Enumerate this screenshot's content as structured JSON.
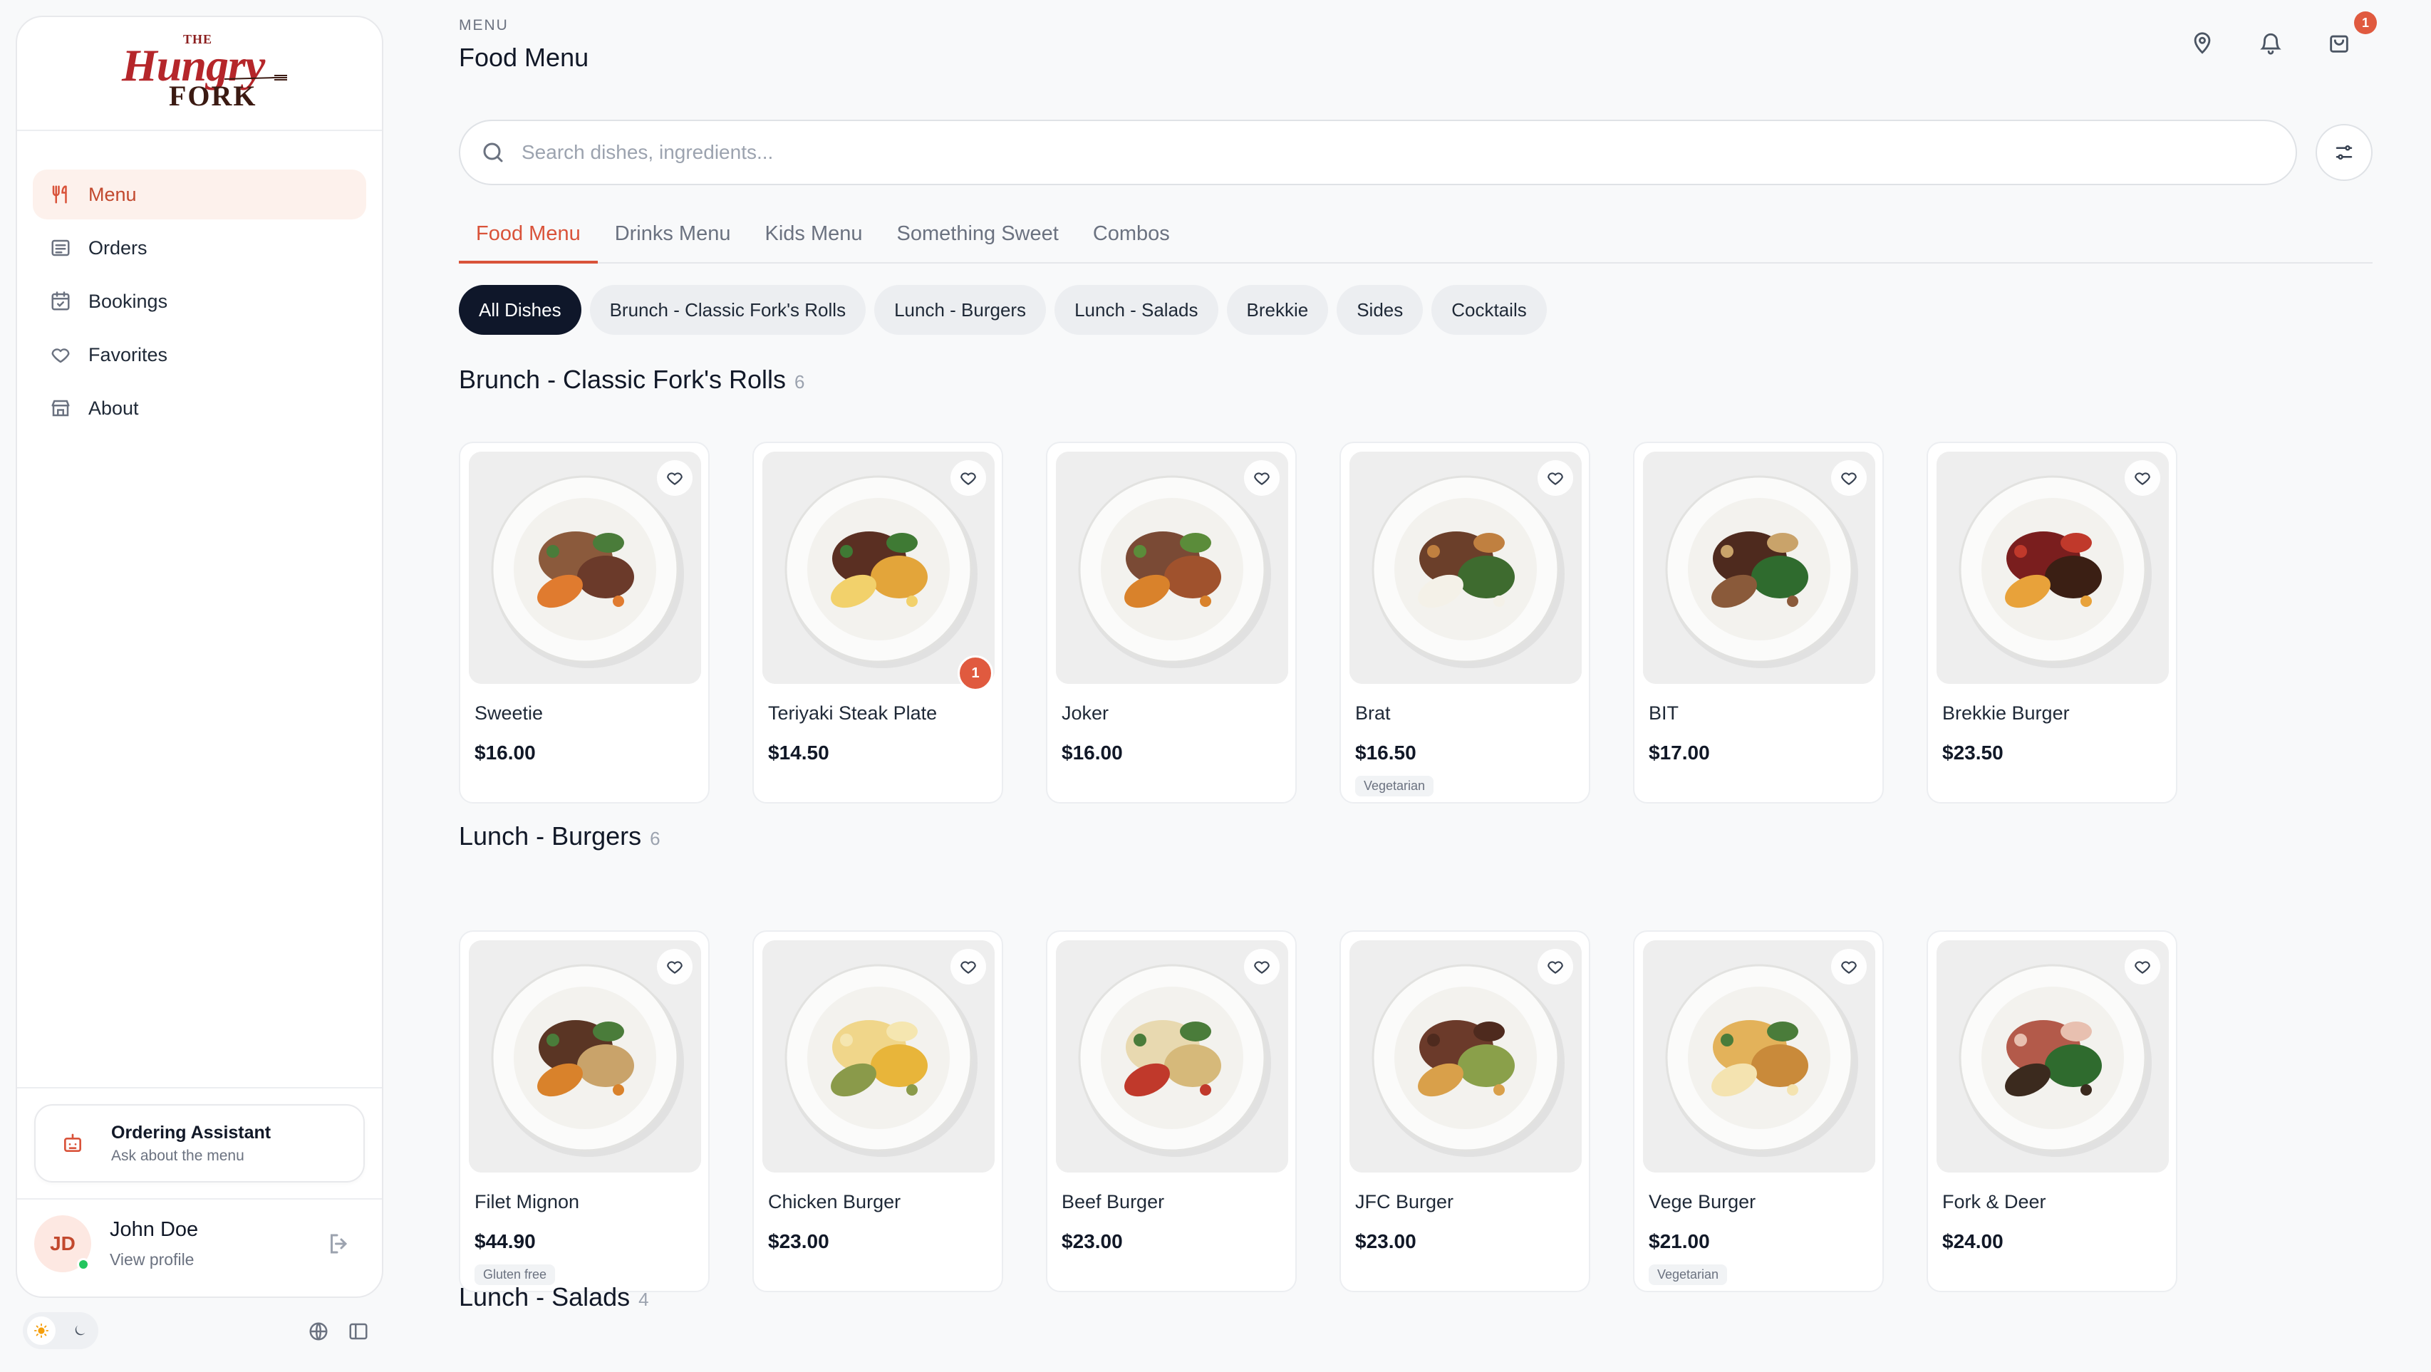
{
  "brand": {
    "logo_top": "THE",
    "logo_main": "Hungry",
    "logo_bottom": "FORK"
  },
  "sidebar": {
    "items": [
      {
        "label": "Menu",
        "icon": "utensils-icon",
        "active": true
      },
      {
        "label": "Orders",
        "icon": "receipt-icon"
      },
      {
        "label": "Bookings",
        "icon": "calendar-check-icon"
      },
      {
        "label": "Favorites",
        "icon": "heart-icon"
      },
      {
        "label": "About",
        "icon": "store-icon"
      }
    ],
    "assistant": {
      "title": "Ordering Assistant",
      "subtitle": "Ask about the menu"
    },
    "user": {
      "initials": "JD",
      "name": "John Doe",
      "link": "View profile"
    }
  },
  "header": {
    "crumb": "MENU",
    "title": "Food Menu",
    "cart_count": "1"
  },
  "search": {
    "placeholder": "Search dishes, ingredients..."
  },
  "tabs": [
    "Food Menu",
    "Drinks Menu",
    "Kids Menu",
    "Something Sweet",
    "Combos"
  ],
  "active_tab": 0,
  "chips": [
    "All Dishes",
    "Brunch - Classic Fork's Rolls",
    "Lunch - Burgers",
    "Lunch - Salads",
    "Brekkie",
    "Sides",
    "Cocktails"
  ],
  "active_chip": 0,
  "sections": [
    {
      "title": "Brunch - Classic Fork's Rolls",
      "count": "6",
      "dishes": [
        {
          "name": "Sweetie",
          "price": "$16.00",
          "tag": ""
        },
        {
          "name": "Teriyaki Steak Plate",
          "price": "$14.50",
          "tag": "",
          "qty": "1"
        },
        {
          "name": "Joker",
          "price": "$16.00",
          "tag": ""
        },
        {
          "name": "Brat",
          "price": "$16.50",
          "tag": "Vegetarian"
        },
        {
          "name": "BIT",
          "price": "$17.00",
          "tag": ""
        },
        {
          "name": "Brekkie Burger",
          "price": "$23.50",
          "tag": ""
        }
      ]
    },
    {
      "title": "Lunch - Burgers",
      "count": "6",
      "dishes": [
        {
          "name": "Filet Mignon",
          "price": "$44.90",
          "tag": "Gluten free"
        },
        {
          "name": "Chicken Burger",
          "price": "$23.00",
          "tag": ""
        },
        {
          "name": "Beef Burger",
          "price": "$23.00",
          "tag": ""
        },
        {
          "name": "JFC Burger",
          "price": "$23.00",
          "tag": ""
        },
        {
          "name": "Vege Burger",
          "price": "$21.00",
          "tag": "Vegetarian"
        },
        {
          "name": "Fork & Deer",
          "price": "$24.00",
          "tag": ""
        }
      ]
    },
    {
      "title": "Lunch - Salads",
      "count": "4",
      "dishes": []
    }
  ],
  "colors": {
    "accent": "#d9533a",
    "active_chip": "#0f172a",
    "badge": "#e05a3f",
    "online": "#22c55e"
  }
}
